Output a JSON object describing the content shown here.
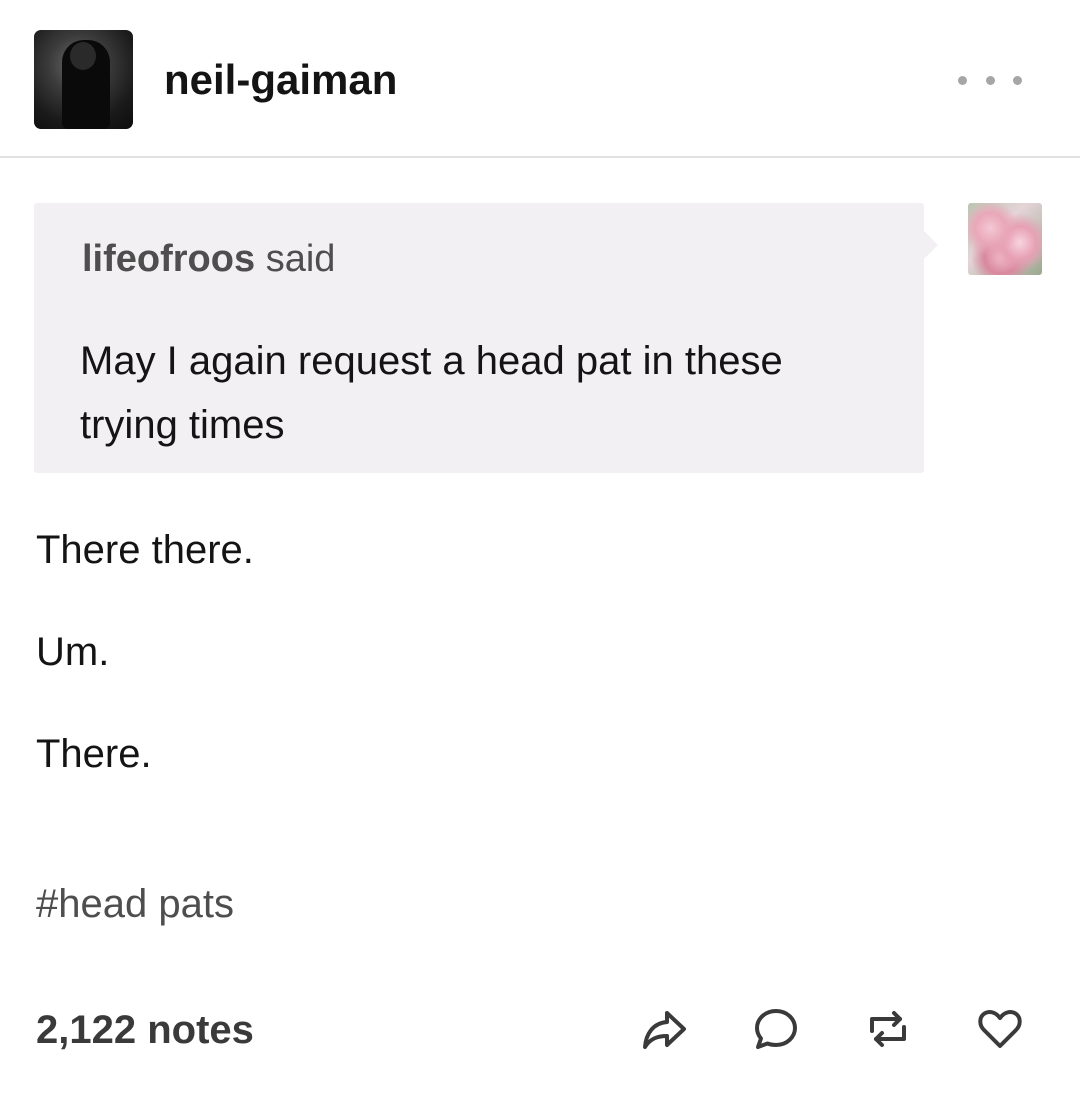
{
  "header": {
    "blog_name": "neil-gaiman",
    "more_icon": "ellipsis-icon"
  },
  "ask": {
    "asker_name": "lifeofroos",
    "said_label": "said",
    "question": "May I again request a head pat in these trying times"
  },
  "answer": {
    "paragraphs": [
      "There there.",
      "Um.",
      "There."
    ]
  },
  "tags": [
    "#head pats"
  ],
  "footer": {
    "notes_count": "2,122 notes",
    "actions": [
      "share-icon",
      "reply-icon",
      "reblog-icon",
      "heart-icon"
    ]
  },
  "colors": {
    "ask_background": "#f3f0f3",
    "divider": "#e2e2e2",
    "text": "#141414",
    "muted_text": "#4e4e4e"
  }
}
